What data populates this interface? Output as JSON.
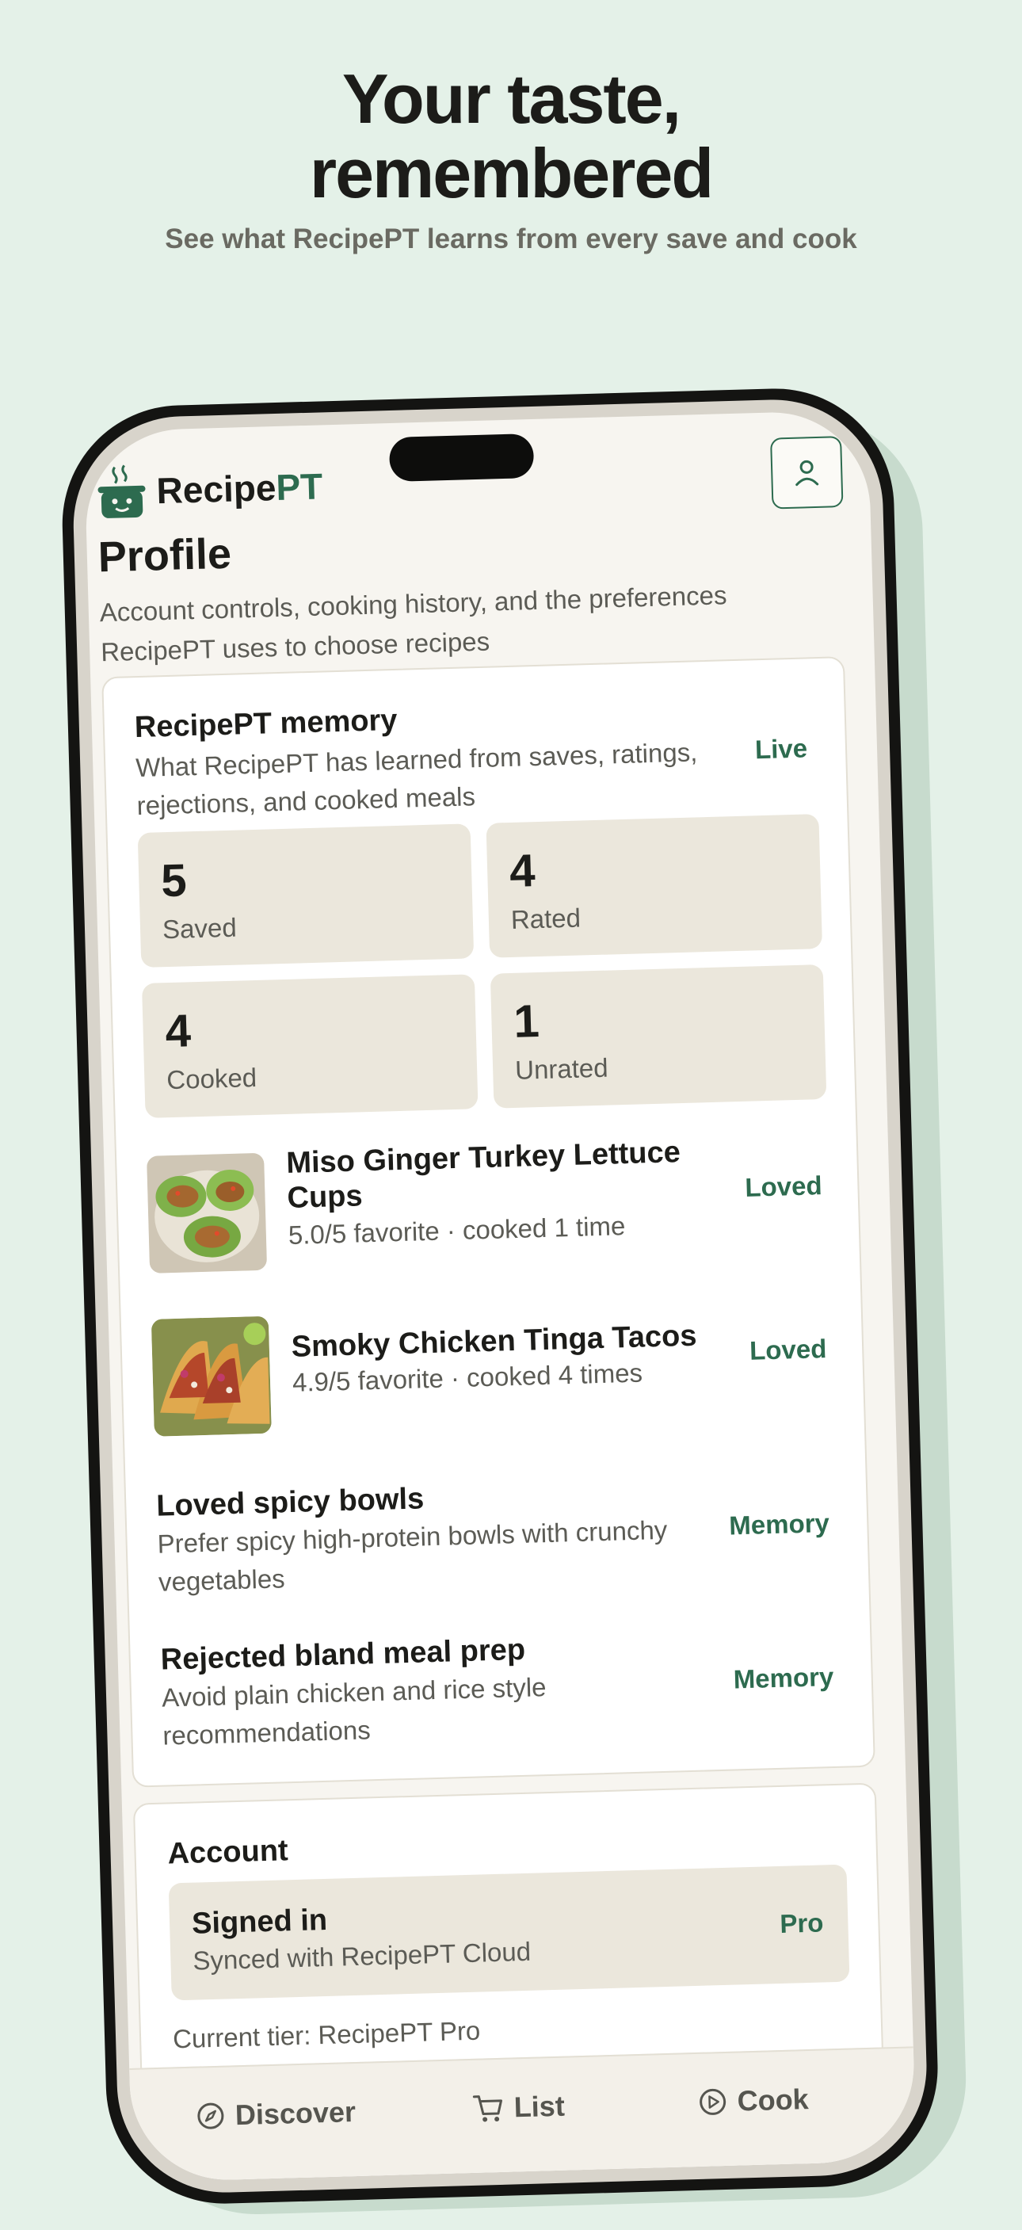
{
  "hero": {
    "headline_line1": "Your taste,",
    "headline_line2": "remembered",
    "subhead": "See what RecipePT learns from every save and cook"
  },
  "app": {
    "brand_main": "Recipe",
    "brand_accent": "PT",
    "account_icon": "person-icon"
  },
  "profile": {
    "title": "Profile",
    "description": "Account controls, cooking history, and the preferences RecipePT uses to choose recipes"
  },
  "memory": {
    "title": "RecipePT memory",
    "subtitle": "What RecipePT has learned from saves, ratings, rejections, and cooked meals",
    "status": "Live",
    "stats": [
      {
        "value": "5",
        "label": "Saved"
      },
      {
        "value": "4",
        "label": "Rated"
      },
      {
        "value": "4",
        "label": "Cooked"
      },
      {
        "value": "1",
        "label": "Unrated"
      }
    ],
    "recipes": [
      {
        "name": "Miso Ginger Turkey Lettuce Cups",
        "meta": "5.0/5 favorite · cooked 1 time",
        "tag": "Loved"
      },
      {
        "name": "Smoky Chicken Tinga Tacos",
        "meta": "4.9/5 favorite · cooked 4 times",
        "tag": "Loved"
      }
    ],
    "notes": [
      {
        "title": "Loved spicy bowls",
        "text": "Prefer spicy high-protein bowls with crunchy vegetables",
        "tag": "Memory"
      },
      {
        "title": "Rejected bland meal prep",
        "text": "Avoid plain chicken and rice style recommendations",
        "tag": "Memory"
      }
    ]
  },
  "account": {
    "title": "Account",
    "status_title": "Signed in",
    "status_sub": "Synced with RecipePT Cloud",
    "tier_badge": "Pro",
    "current_tier": "Current tier: RecipePT Pro"
  },
  "tabs": [
    {
      "label": "Discover",
      "icon": "compass-icon"
    },
    {
      "label": "List",
      "icon": "cart-icon"
    },
    {
      "label": "Cook",
      "icon": "play-icon"
    }
  ],
  "colors": {
    "background": "#e4f1e8",
    "accent": "#2d6b4f",
    "card": "#ffffff",
    "stat_tile": "#ebe7dc"
  }
}
